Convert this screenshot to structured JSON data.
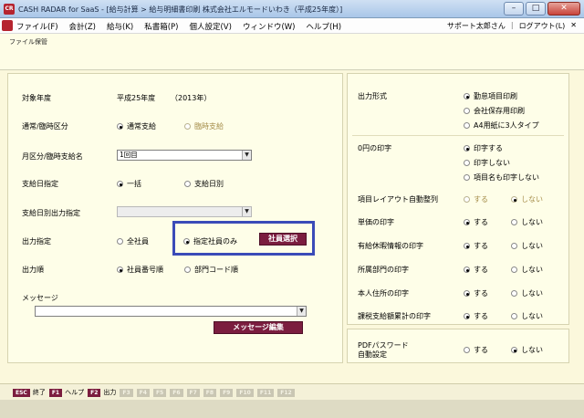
{
  "window": {
    "title": "CASH RADAR for SaaS - [給与計算 > 給与明細書印刷 株式会社エルモードいわき（平成25年度）]",
    "minimize": "–",
    "maximize": "□",
    "close": "✕"
  },
  "menu": {
    "items": [
      "ファイル(F)",
      "会計(Z)",
      "給与(K)",
      "私書箱(P)",
      "個人設定(V)",
      "ウィンドウ(W)",
      "ヘルプ(H)"
    ],
    "user": "サポート太郎さん",
    "separator": "|",
    "logout": "ログアウト(L)",
    "close_x": "✕"
  },
  "subheader": {
    "label": "ファイル保管"
  },
  "form": {
    "year_label": "対象年度",
    "year_value": "平成25年度",
    "year_western": "（2013年）",
    "type_label": "通常/臨時区分",
    "type_regular": "通常支給",
    "type_special": "臨時支給",
    "month_label": "月区分/臨時支給名",
    "month_value": "1回目",
    "paydate_label": "支給日指定",
    "paydate_bulk": "一括",
    "paydate_each": "支給日別",
    "paydate_output_label": "支給日別出力指定",
    "output_label": "出力指定",
    "output_all": "全社員",
    "output_selected": "指定社員のみ",
    "select_employee": "社員選択",
    "order_label": "出力順",
    "order_number": "社員番号順",
    "order_dept": "部門コード順",
    "message_label": "メッセージ",
    "message_edit": "メッセージ編集"
  },
  "right": {
    "format_label": "出力形式",
    "format_options": [
      "勤怠項目印刷",
      "会社保存用印刷",
      "A4用紙に3人タイプ"
    ],
    "zero_label": "0円の印字",
    "zero_options": [
      "印字する",
      "印字しない",
      "項目名も印字しない"
    ],
    "layout_label": "項目レイアウト自動整列",
    "unit_label": "単価の印字",
    "leave_label": "有給休暇情報の印字",
    "dept_label": "所属部門の印字",
    "address_label": "本人住所の印字",
    "tax_label": "課税支給額累計の印字",
    "yes": "する",
    "no": "しない",
    "pdf_label_1": "PDFパスワード",
    "pdf_label_2": "自動設定"
  },
  "fkeys": [
    {
      "key": "ESC",
      "label": "終了"
    },
    {
      "key": "F1",
      "label": "ヘルプ"
    },
    {
      "key": "F2",
      "label": "出力"
    },
    {
      "key": "F3",
      "label": ""
    },
    {
      "key": "F4",
      "label": ""
    },
    {
      "key": "F5",
      "label": ""
    },
    {
      "key": "F6",
      "label": ""
    },
    {
      "key": "F7",
      "label": ""
    },
    {
      "key": "F8",
      "label": ""
    },
    {
      "key": "F9",
      "label": ""
    },
    {
      "key": "F10",
      "label": ""
    },
    {
      "key": "F11",
      "label": ""
    },
    {
      "key": "F12",
      "label": ""
    }
  ],
  "icons": {
    "app": "app-logo-icon",
    "dropdown": "chevron-down-icon"
  },
  "colors": {
    "accent": "#7b1d3f",
    "highlight": "#3b4bb8",
    "background": "#fbf8dc"
  }
}
